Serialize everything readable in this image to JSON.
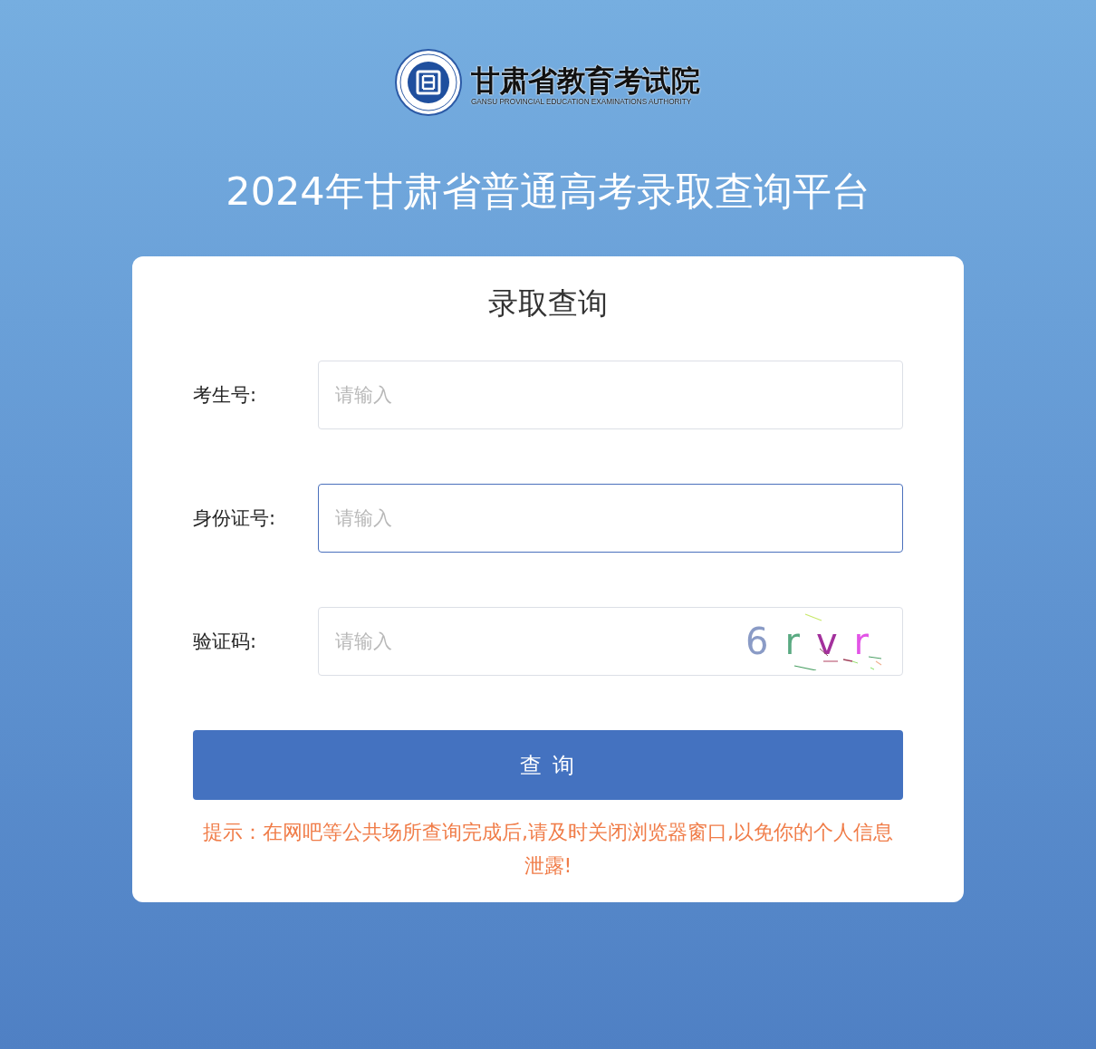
{
  "logo": {
    "title": "甘肃省教育考试院",
    "subtitle": "GANSU PROVINCIAL EDUCATION EXAMINATIONS AUTHORITY"
  },
  "page_title": "2024年甘肃省普通高考录取查询平台",
  "form": {
    "title": "录取查询",
    "fields": [
      {
        "label": "考生号:",
        "placeholder": "请输入",
        "focused": false,
        "kind": "text"
      },
      {
        "label": "身份证号:",
        "placeholder": "请输入",
        "focused": true,
        "kind": "text"
      },
      {
        "label": "验证码:",
        "placeholder": "请输入",
        "focused": false,
        "kind": "captcha"
      }
    ],
    "captcha": {
      "chars": [
        {
          "char": "6",
          "color": "#8a9bc6"
        },
        {
          "char": "r",
          "color": "#5aaa82"
        },
        {
          "char": "v",
          "color": "#a3309c"
        },
        {
          "char": "r",
          "color": "#e254e6"
        }
      ]
    },
    "submit": "查 询",
    "tip": "提示：在网吧等公共场所查询完成后,请及时关闭浏览器窗口,以免你的个人信息泄露!"
  }
}
